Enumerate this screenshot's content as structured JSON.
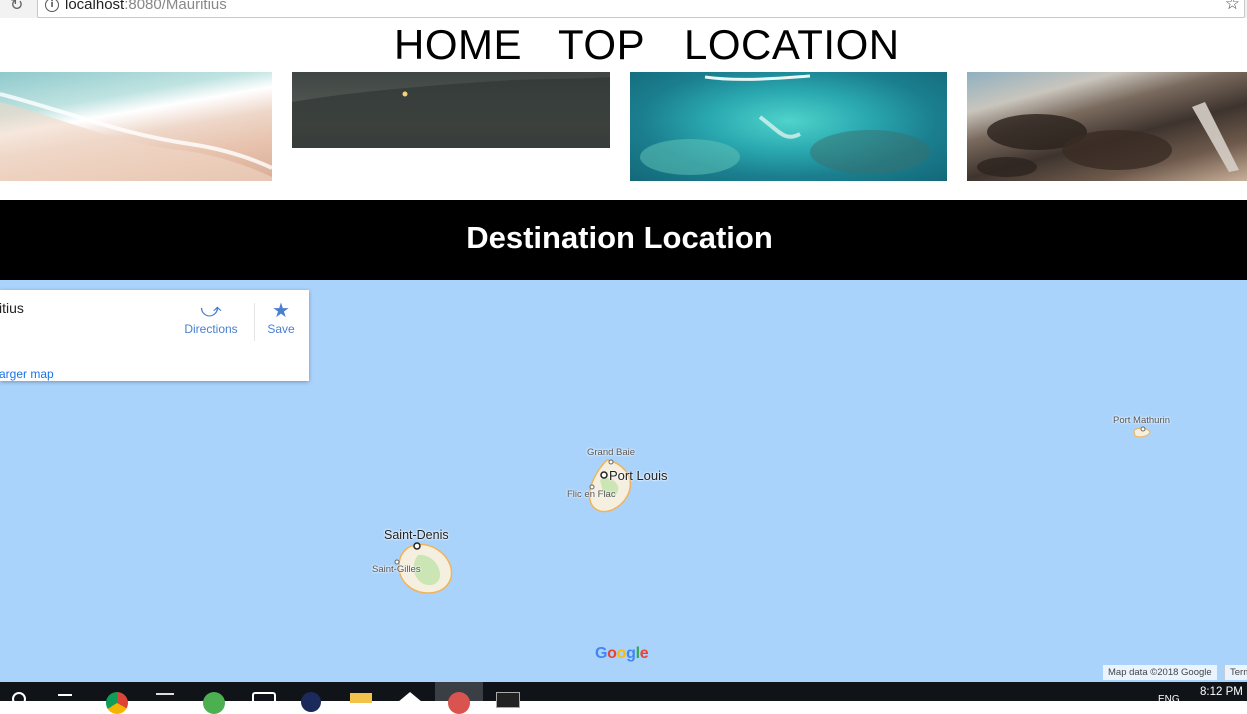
{
  "browser": {
    "url_host": "localhost",
    "url_rest": ":8080/Mauritius"
  },
  "nav": {
    "home": "HOME",
    "top": "TOP",
    "location": "LOCATION"
  },
  "banner": {
    "title": "Destination Location"
  },
  "map": {
    "card": {
      "place": "itius",
      "directions": "Directions",
      "save": "Save",
      "larger_map": "arger map"
    },
    "labels": {
      "grand_baie": "Grand Baie",
      "port_louis": "Port Louis",
      "flic_en_flac": "Flic en Flac",
      "saint_denis": "Saint-Denis",
      "saint_gilles": "Saint-Gilles",
      "port_mathurin": "Port Mathurin"
    },
    "logo": "Google",
    "attribution": "Map data ©2018 Google",
    "terms": "Term"
  },
  "taskbar": {
    "time": "8:12 PM",
    "lang": "ENG"
  },
  "colors": {
    "water": "#aad3fb",
    "banner": "#000000",
    "link_blue": "#4a7fcf"
  }
}
